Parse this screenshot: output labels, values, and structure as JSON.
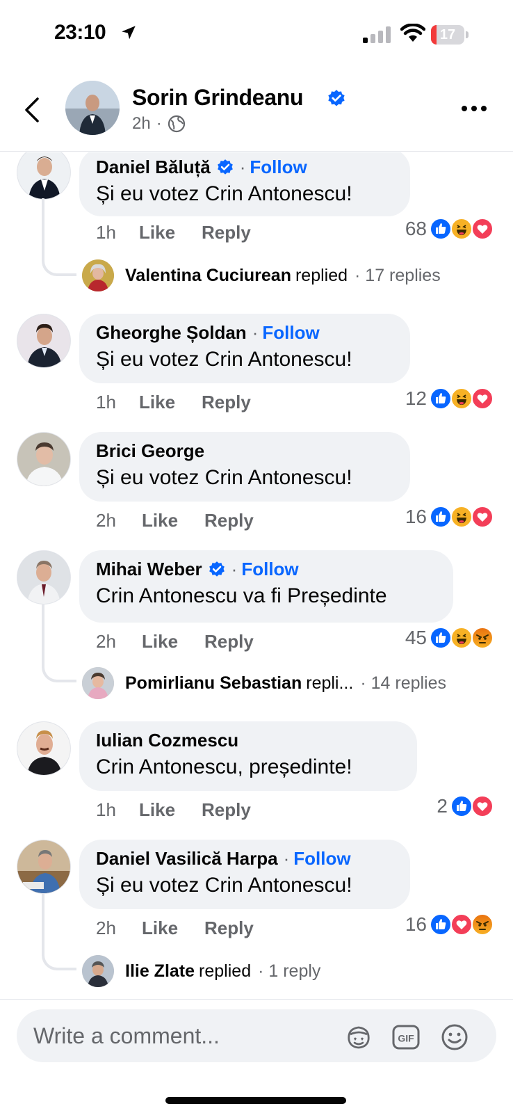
{
  "status_bar": {
    "time": "23:10",
    "battery_level": "17",
    "icons": [
      "location-arrow-icon",
      "cellular-signal-icon",
      "wifi-icon",
      "battery-icon"
    ]
  },
  "header": {
    "name": "Sorin Grindeanu",
    "time": "2h",
    "meta_separator": "·",
    "icons": [
      "back-chevron-icon",
      "verified-badge-icon",
      "globe-icon",
      "more-dots-icon"
    ]
  },
  "comments": [
    {
      "author": "Daniel Băluță",
      "verified": true,
      "follow": "Follow",
      "text": "Și eu votez Crin Antonescu!",
      "time": "1h",
      "like": "Like",
      "reply": "Reply",
      "reaction_count": "68",
      "reactions": [
        "like",
        "haha",
        "love"
      ],
      "replies": {
        "name": "Valentina Cuciurean",
        "action": "replied",
        "count": "· 17 replies"
      }
    },
    {
      "author": "Gheorghe Șoldan",
      "verified": false,
      "follow": "Follow",
      "text": "Și eu votez Crin Antonescu!",
      "time": "1h",
      "like": "Like",
      "reply": "Reply",
      "reaction_count": "12",
      "reactions": [
        "like",
        "haha",
        "love"
      ]
    },
    {
      "author": "Brici George",
      "verified": false,
      "follow": "",
      "text": "Și eu votez Crin Antonescu!",
      "time": "2h",
      "like": "Like",
      "reply": "Reply",
      "reaction_count": "16",
      "reactions": [
        "like",
        "haha",
        "love"
      ]
    },
    {
      "author": "Mihai Weber",
      "verified": true,
      "follow": "Follow",
      "text": "Crin Antonescu va fi Președinte",
      "time": "2h",
      "like": "Like",
      "reply": "Reply",
      "reaction_count": "45",
      "reactions": [
        "like",
        "haha",
        "angry"
      ],
      "replies": {
        "name": "Pomirlianu Sebastian",
        "action": "repli...",
        "count": "· 14 replies"
      }
    },
    {
      "author": "Iulian Cozmescu",
      "verified": false,
      "follow": "",
      "text": "Crin Antonescu, președinte!",
      "time": "1h",
      "like": "Like",
      "reply": "Reply",
      "reaction_count": "2",
      "reactions": [
        "like",
        "love"
      ]
    },
    {
      "author": "Daniel Vasilică Harpa",
      "verified": false,
      "follow": "Follow",
      "text": "Și eu votez Crin Antonescu!",
      "time": "2h",
      "like": "Like",
      "reply": "Reply",
      "reaction_count": "16",
      "reactions": [
        "like",
        "love",
        "angry"
      ],
      "replies": {
        "name": "Ilie Zlate",
        "action": "replied",
        "count": "· 1 reply"
      }
    }
  ],
  "composer": {
    "placeholder": "Write a comment...",
    "icons": [
      "avatar-sticker-icon",
      "gif-icon",
      "emoji-icon"
    ]
  },
  "colors": {
    "accent": "#0866ff",
    "bubble": "#f0f2f5",
    "secondary_text": "#65676b",
    "love": "#f33e58",
    "haha_angry": "#f7b125"
  }
}
